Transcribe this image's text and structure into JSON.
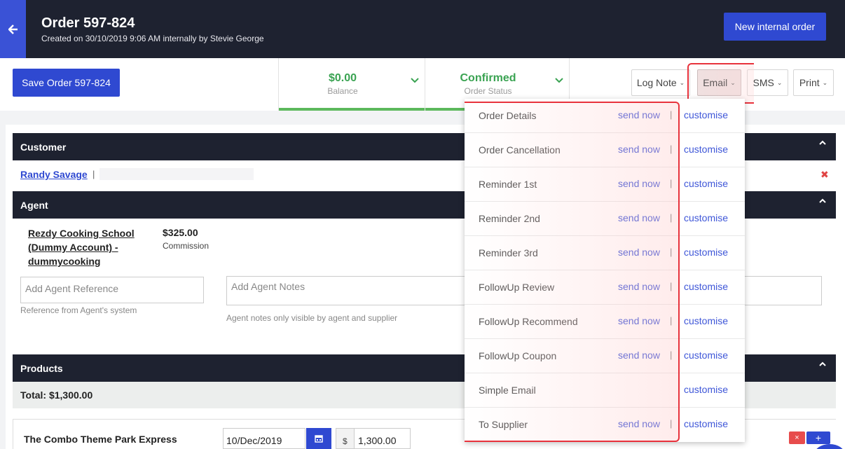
{
  "header": {
    "title": "Order 597-824",
    "subtitle": "Created on 30/10/2019 9:06 AM internally by Stevie George",
    "new_order_label": "New internal order"
  },
  "toolbar": {
    "save_label": "Save Order 597-824",
    "balance_value": "$0.00",
    "balance_label": "Balance",
    "status_value": "Confirmed",
    "status_label": "Order Status",
    "log_note_label": "Log Note",
    "email_label": "Email",
    "sms_label": "SMS",
    "print_label": "Print"
  },
  "customer": {
    "section_title": "Customer",
    "name": "Randy Savage",
    "separator": "|"
  },
  "agent": {
    "section_title": "Agent",
    "name": "Rezdy Cooking School (Dummy Account) - dummycooking",
    "amount": "$325.00",
    "amount_label": "Commission",
    "reference_placeholder": "Add Agent Reference",
    "reference_hint": "Reference from Agent's system",
    "notes_placeholder": "Add Agent Notes",
    "notes_hint": "Agent notes only visible by agent and supplier"
  },
  "products": {
    "section_title": "Products",
    "total": "Total: $1,300.00",
    "item_name": "The Combo Theme Park Express",
    "date": "10/Dec/2019",
    "currency": "$",
    "price": "1,300.00",
    "remove_label": "×",
    "add_label": "+"
  },
  "email_menu": {
    "items": [
      {
        "name": "Order Details",
        "send": "send now",
        "sep": "|",
        "customise": "customise"
      },
      {
        "name": "Order Cancellation",
        "send": "send now",
        "sep": "|",
        "customise": "customise"
      },
      {
        "name": "Reminder 1st",
        "send": "send now",
        "sep": "|",
        "customise": "customise"
      },
      {
        "name": "Reminder 2nd",
        "send": "send now",
        "sep": "|",
        "customise": "customise"
      },
      {
        "name": "Reminder 3rd",
        "send": "send now",
        "sep": "|",
        "customise": "customise"
      },
      {
        "name": "FollowUp Review",
        "send": "send now",
        "sep": "|",
        "customise": "customise"
      },
      {
        "name": "FollowUp Recommend",
        "send": "send now",
        "sep": "|",
        "customise": "customise"
      },
      {
        "name": "FollowUp Coupon",
        "send": "send now",
        "sep": "|",
        "customise": "customise"
      },
      {
        "name": "Simple Email",
        "send": "",
        "sep": "",
        "customise": "customise"
      },
      {
        "name": "To Supplier",
        "send": "send now",
        "sep": "|",
        "customise": "customise"
      }
    ]
  },
  "colors": {
    "header_bg": "#1e2230",
    "primary": "#2f49d1",
    "success": "#3aa352",
    "highlight": "#e8323c"
  }
}
